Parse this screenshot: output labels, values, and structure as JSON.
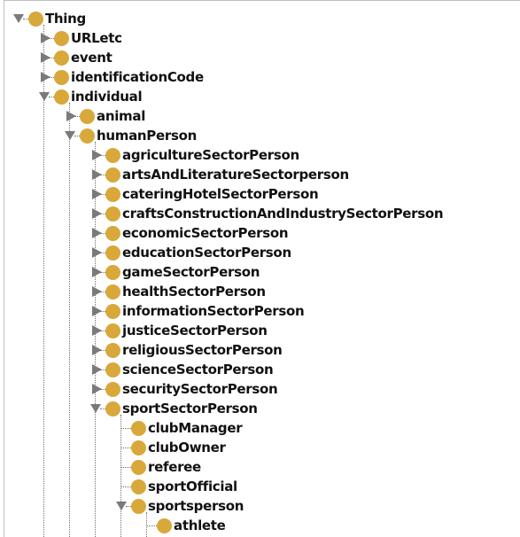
{
  "tree": {
    "nodes": [
      {
        "label": "Thing",
        "depth": 0,
        "state": "expanded"
      },
      {
        "label": "URLetc",
        "depth": 1,
        "state": "collapsed"
      },
      {
        "label": "event",
        "depth": 1,
        "state": "collapsed"
      },
      {
        "label": "identificationCode",
        "depth": 1,
        "state": "collapsed"
      },
      {
        "label": "individual",
        "depth": 1,
        "state": "expanded"
      },
      {
        "label": "animal",
        "depth": 2,
        "state": "collapsed"
      },
      {
        "label": "humanPerson",
        "depth": 2,
        "state": "expanded"
      },
      {
        "label": "agricultureSectorPerson",
        "depth": 3,
        "state": "collapsed"
      },
      {
        "label": "artsAndLiteratureSectorperson",
        "depth": 3,
        "state": "collapsed"
      },
      {
        "label": "cateringHotelSectorPerson",
        "depth": 3,
        "state": "collapsed"
      },
      {
        "label": "craftsConstructionAndIndustrySectorPerson",
        "depth": 3,
        "state": "collapsed"
      },
      {
        "label": "economicSectorPerson",
        "depth": 3,
        "state": "collapsed"
      },
      {
        "label": "educationSectorPerson",
        "depth": 3,
        "state": "collapsed"
      },
      {
        "label": "gameSectorPerson",
        "depth": 3,
        "state": "collapsed"
      },
      {
        "label": "healthSectorPerson",
        "depth": 3,
        "state": "collapsed"
      },
      {
        "label": "informationSectorPerson",
        "depth": 3,
        "state": "collapsed"
      },
      {
        "label": "justiceSectorPerson",
        "depth": 3,
        "state": "collapsed"
      },
      {
        "label": "religiousSectorPerson",
        "depth": 3,
        "state": "collapsed"
      },
      {
        "label": "scienceSectorPerson",
        "depth": 3,
        "state": "collapsed"
      },
      {
        "label": "securitySectorPerson",
        "depth": 3,
        "state": "collapsed"
      },
      {
        "label": "sportSectorPerson",
        "depth": 3,
        "state": "expanded"
      },
      {
        "label": "clubManager",
        "depth": 4,
        "state": "leaf"
      },
      {
        "label": "clubOwner",
        "depth": 4,
        "state": "leaf"
      },
      {
        "label": "referee",
        "depth": 4,
        "state": "leaf"
      },
      {
        "label": "sportOfficial",
        "depth": 4,
        "state": "leaf"
      },
      {
        "label": "sportsperson",
        "depth": 4,
        "state": "expanded"
      },
      {
        "label": "athlete",
        "depth": 5,
        "state": "leaf"
      }
    ]
  },
  "colors": {
    "node_icon": "#d8a83a",
    "toggle": "#7a7a7a",
    "connector": "#707070"
  },
  "icons": {
    "node": "class-circle-icon",
    "expanded": "triangle-down-icon",
    "collapsed": "triangle-right-icon"
  }
}
